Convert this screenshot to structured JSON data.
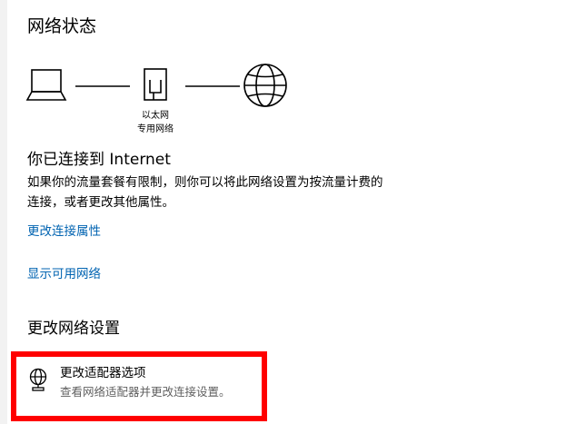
{
  "page": {
    "title": "网络状态"
  },
  "diagram": {
    "adapter_name": "以太网",
    "network_name": "专用网络"
  },
  "status": {
    "heading": "你已连接到 Internet",
    "description": "如果你的流量套餐有限制，则你可以将此网络设置为按流量计费的连接，或者更改其他属性。"
  },
  "links": {
    "change_connection_properties": "更改连接属性",
    "show_available_networks": "显示可用网络"
  },
  "change_settings": {
    "heading": "更改网络设置",
    "adapter_options": {
      "title": "更改适配器选项",
      "description": "查看网络适配器并更改连接设置。",
      "icon": "globe-adapter-icon"
    }
  },
  "colors": {
    "link": "#0063b1",
    "highlight": "#ff0000",
    "secondary_text": "#5f5f5f"
  }
}
